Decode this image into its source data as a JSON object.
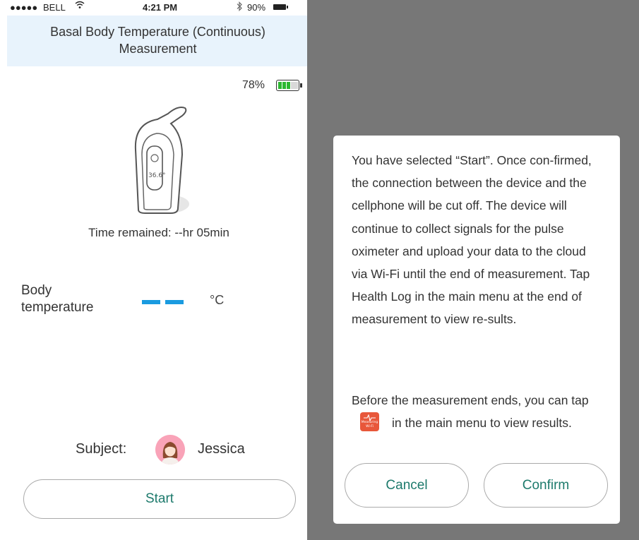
{
  "status_bar": {
    "signal": "●●●●●",
    "carrier": "BELL",
    "wifi_icon": "wifi-icon",
    "time": "4:21 PM",
    "bluetooth_icon": "bluetooth-icon",
    "battery_percent": "90%"
  },
  "header": {
    "title": "Basal Body Temperature (Continuous) Measurement"
  },
  "device": {
    "battery_percent": "78%",
    "battery_level": 0.6,
    "battery_color": "#2db832",
    "display_reading": "36.6°"
  },
  "measurement": {
    "time_remained": "Time remained: --hr 05min",
    "body_label_line1": "Body",
    "body_label_line2": "temperature",
    "value_placeholder_color": "#1a9be0",
    "unit": "°C"
  },
  "subject": {
    "label": "Subject:",
    "name": "Jessica",
    "avatar_icon": "user-avatar-icon"
  },
  "start_button": {
    "label": "Start"
  },
  "dialog": {
    "message": "You have selected “Start”. Once con-firmed, the connection between the device and the cellphone will be cut off. The device will continue to collect signals for the pulse oximeter and upload your data to the cloud via Wi-Fi until the end of measurement. Tap Health Log in the main menu at the end of measurement to view re-sults.",
    "note_before": "Before the measurement ends, you can tap",
    "note_after": "in the main menu to view results.",
    "app_icon": {
      "name": "measuring-wifi-icon",
      "line1": "Measuring",
      "line2": "Wi-Fi",
      "color": "#e8573a"
    },
    "cancel_label": "Cancel",
    "confirm_label": "Confirm"
  },
  "colors": {
    "header_bg": "#e8f3fc",
    "overlay": "#777777",
    "button_text": "#1d7a6c"
  }
}
